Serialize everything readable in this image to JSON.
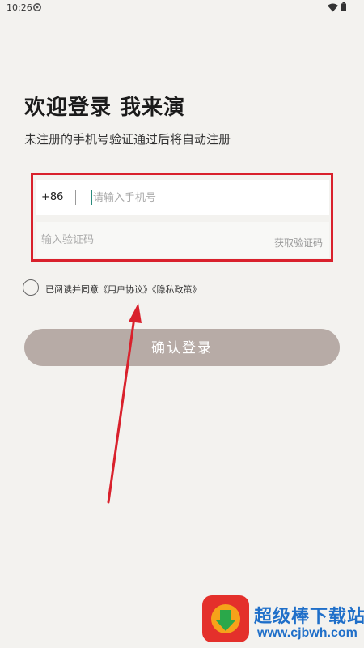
{
  "status_bar": {
    "time": "10:26"
  },
  "header": {
    "title": "欢迎登录 我来演",
    "subtitle": "未注册的手机号验证通过后将自动注册"
  },
  "form": {
    "country_code": "+86",
    "phone_placeholder": "请输入手机号",
    "code_placeholder": "输入验证码",
    "get_code_label": "获取验证码"
  },
  "agreement": {
    "prefix": "已阅读并同意",
    "user_agreement": "《用户协议》",
    "privacy_policy": "《隐私政策》",
    "checked": false
  },
  "login_button": {
    "label": "确认登录"
  },
  "watermark": {
    "text": "超级棒下载站",
    "url": "www.cjbwh.com"
  },
  "colors": {
    "background": "#f3f2ef",
    "highlight_red": "#d9212c",
    "button_disabled": "#b7aba6",
    "caret": "#2a8a7c",
    "watermark_blue": "#1f6fc9"
  }
}
